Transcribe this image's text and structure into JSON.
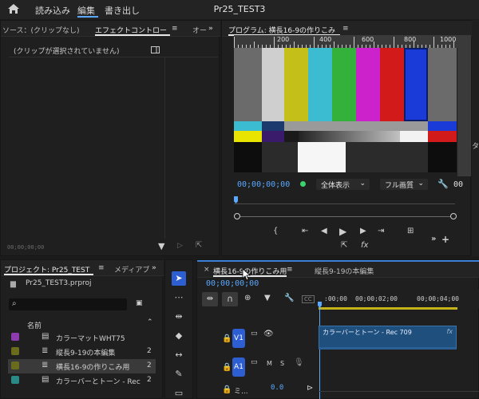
{
  "menubar": {
    "home_icon": "home-icon",
    "items": [
      "読み込み",
      "編集",
      "書き出し"
    ],
    "title": "Pr25_TEST3"
  },
  "source_panel": {
    "tabs": [
      "ソース：(クリップなし)",
      "エフェクトコントロー",
      "オー"
    ],
    "empty_message": "(クリップが選択されていません)",
    "timecode": "00;00;00;00"
  },
  "program_monitor": {
    "tab_label": "プログラム: 横長16-9の作りこみ",
    "ruler_labels": [
      "200",
      "400",
      "600",
      "800",
      "1000"
    ],
    "timecode": "00;00;00;00",
    "zoom_select": "全体表示",
    "quality_select": "フル画質",
    "right_timecode": "00",
    "colors": {
      "top_bars": [
        "#6b6b6b",
        "#cfcfcf",
        "#c5bf1a",
        "#3bbcd0",
        "#34b13a",
        "#cc22cc",
        "#d21a1a",
        "#1b3bd8",
        "#6b6b6b"
      ],
      "accent_blue": "#5aa8ff"
    }
  },
  "project_panel": {
    "tabs": [
      "プロジェクト: Pr25_TEST",
      "メディアブ"
    ],
    "file": "Pr25_TEST3.prproj",
    "name_header": "名前",
    "items": [
      {
        "label": "カラーマットWHT75",
        "color": "#8e3bb0",
        "icon": "film-icon",
        "num": ""
      },
      {
        "label": "縦長9-19の本編集",
        "color": "#6b6b1e",
        "icon": "sequence-icon",
        "num": "2"
      },
      {
        "label": "横長16-9の作りこみ用",
        "color": "#6b6b1e",
        "icon": "sequence-icon",
        "num": "2"
      },
      {
        "label": "カラーバーとトーン - Rec",
        "color": "#2a8a88",
        "icon": "film-icon",
        "num": "2"
      }
    ]
  },
  "timeline": {
    "tabs": [
      "横長16-9の作りこみ用",
      "縦長9-19の本編集"
    ],
    "timecode": "00;00;00;00",
    "ruler_labels": [
      ":00;00",
      "00;00;02;00",
      "00;00;04;00"
    ],
    "tracks": {
      "v1": "V1",
      "a1": "A1",
      "mix_label": "ミ...",
      "mix_value": "0.0",
      "m": "M",
      "s": "S"
    },
    "clip_label": "カラーバーとトーン - Rec 709",
    "clip_fx": "fx"
  }
}
